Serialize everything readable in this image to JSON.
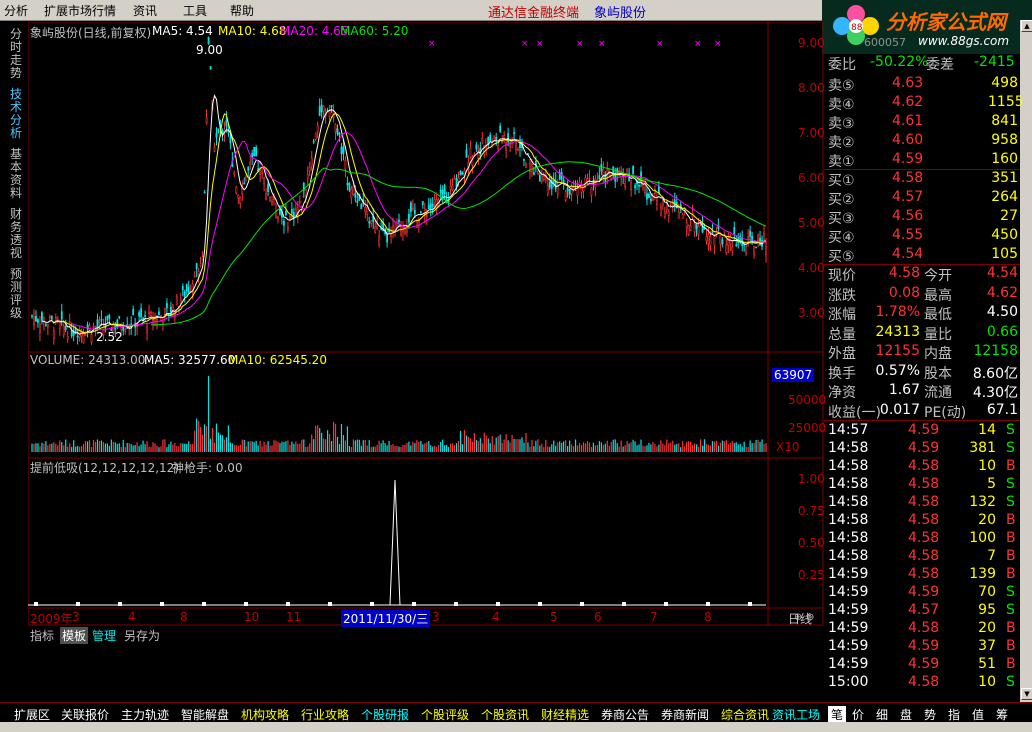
{
  "menu": [
    "分析",
    "扩展市场行情",
    "资讯",
    "工具",
    "帮助"
  ],
  "app_title": "通达信金融终端",
  "stock_title": "象屿股份",
  "logo": {
    "text": "分析家公式网",
    "url": "www.88gs.com",
    "code": "600057",
    "name": "象屿股份"
  },
  "left_tabs": [
    {
      "label": "分时走势",
      "active": false
    },
    {
      "label": "技术分析",
      "active": true
    },
    {
      "label": "基本资料",
      "active": false
    },
    {
      "label": "财务透视",
      "active": false
    },
    {
      "label": "预测评级",
      "active": false
    }
  ],
  "main_header": {
    "name": "象屿股份(日线,前复权)",
    "ma5": "MA5: 4.54",
    "ma10": "MA10: 4.68",
    "ma20": "MA20: 4.65",
    "ma60": "MA60: 5.20"
  },
  "price_axis": [
    "9.00",
    "8.00",
    "7.00",
    "6.00",
    "5.00",
    "4.00",
    "3.00"
  ],
  "price_annotations": {
    "high": "9.00",
    "low": "2.52"
  },
  "volume_header": {
    "name": "VOLUME: 24313.00",
    "ma5": "MA5: 32577.60",
    "ma10": "MA10: 62545.20"
  },
  "volume_axis": {
    "top_box": "63907",
    "mid": "50000",
    "low": "25000",
    "unit": "X10"
  },
  "indicator_header": {
    "name": "提前低吸(12,12,12,12,12)",
    "value": "神枪手: 0.00"
  },
  "indicator_axis": [
    "1.00",
    "0.75",
    "0.50",
    "0.25"
  ],
  "date_axis": {
    "labels": [
      "2009年",
      "3",
      "4",
      "8",
      "10",
      "11",
      "3",
      "4",
      "5",
      "6",
      "7",
      "8"
    ],
    "cursor_date": "2011/11/30/三",
    "period": "日线"
  },
  "sub_tabs": [
    "指标",
    "模板",
    "管理",
    "另存为"
  ],
  "quote": {
    "header": {
      "left_label": "委比",
      "left_value": "-50.22%",
      "right_label": "委差",
      "right_value": "-2415"
    },
    "asks": [
      {
        "label": "卖⑤",
        "price": "4.63",
        "vol": "498"
      },
      {
        "label": "卖④",
        "price": "4.62",
        "vol": "1155"
      },
      {
        "label": "卖③",
        "price": "4.61",
        "vol": "841"
      },
      {
        "label": "卖②",
        "price": "4.60",
        "vol": "958"
      },
      {
        "label": "卖①",
        "price": "4.59",
        "vol": "160"
      }
    ],
    "bids": [
      {
        "label": "买①",
        "price": "4.58",
        "vol": "351"
      },
      {
        "label": "买②",
        "price": "4.57",
        "vol": "264"
      },
      {
        "label": "买③",
        "price": "4.56",
        "vol": "27"
      },
      {
        "label": "买④",
        "price": "4.55",
        "vol": "450"
      },
      {
        "label": "买⑤",
        "price": "4.54",
        "vol": "105"
      }
    ],
    "stats": [
      {
        "l1": "现价",
        "v1": "4.58",
        "c1": "red",
        "l2": "今开",
        "v2": "4.54",
        "c2": "red"
      },
      {
        "l1": "涨跌",
        "v1": "0.08",
        "c1": "red",
        "l2": "最高",
        "v2": "4.62",
        "c2": "red"
      },
      {
        "l1": "涨幅",
        "v1": "1.78%",
        "c1": "red",
        "l2": "最低",
        "v2": "4.50",
        "c2": "white"
      },
      {
        "l1": "总量",
        "v1": "24313",
        "c1": "yellow",
        "l2": "量比",
        "v2": "0.66",
        "c2": "green"
      },
      {
        "l1": "外盘",
        "v1": "12155",
        "c1": "red",
        "l2": "内盘",
        "v2": "12158",
        "c2": "green"
      },
      {
        "l1": "换手",
        "v1": "0.57%",
        "c1": "white",
        "l2": "股本",
        "v2": "8.60亿",
        "c2": "white"
      },
      {
        "l1": "净资",
        "v1": "1.67",
        "c1": "white",
        "l2": "流通",
        "v2": "4.30亿",
        "c2": "white"
      },
      {
        "l1": "收益(一)",
        "v1": "0.017",
        "c1": "white",
        "l2": "PE(动)",
        "v2": "67.1",
        "c2": "white"
      }
    ],
    "ticks": [
      {
        "time": "14:57",
        "price": "4.59",
        "vol": "14",
        "side": "S"
      },
      {
        "time": "14:58",
        "price": "4.59",
        "vol": "381",
        "side": "S"
      },
      {
        "time": "14:58",
        "price": "4.58",
        "vol": "10",
        "side": "B"
      },
      {
        "time": "14:58",
        "price": "4.58",
        "vol": "5",
        "side": "S"
      },
      {
        "time": "14:58",
        "price": "4.58",
        "vol": "132",
        "side": "S"
      },
      {
        "time": "14:58",
        "price": "4.58",
        "vol": "20",
        "side": "B"
      },
      {
        "time": "14:58",
        "price": "4.58",
        "vol": "100",
        "side": "B"
      },
      {
        "time": "14:58",
        "price": "4.58",
        "vol": "7",
        "side": "B"
      },
      {
        "time": "14:59",
        "price": "4.58",
        "vol": "139",
        "side": "B"
      },
      {
        "time": "14:59",
        "price": "4.59",
        "vol": "70",
        "side": "S"
      },
      {
        "time": "14:59",
        "price": "4.57",
        "vol": "95",
        "side": "S"
      },
      {
        "time": "14:59",
        "price": "4.58",
        "vol": "20",
        "side": "B"
      },
      {
        "time": "14:59",
        "price": "4.59",
        "vol": "37",
        "side": "B"
      },
      {
        "time": "14:59",
        "price": "4.59",
        "vol": "51",
        "side": "B"
      },
      {
        "time": "15:00",
        "price": "4.58",
        "vol": "10",
        "side": "S"
      }
    ]
  },
  "bottom_tabs": [
    {
      "label": "扩展区",
      "color": "white"
    },
    {
      "label": "关联报价",
      "color": "white"
    },
    {
      "label": "主力轨迹",
      "color": "white"
    },
    {
      "label": "智能解盘",
      "color": "white"
    },
    {
      "label": "机构攻略",
      "color": "yellow"
    },
    {
      "label": "行业攻略",
      "color": "yellow"
    },
    {
      "label": "个股研报",
      "color": "cyan"
    },
    {
      "label": "个股评级",
      "color": "yellow"
    },
    {
      "label": "个股资讯",
      "color": "yellow"
    },
    {
      "label": "财经精选",
      "color": "yellow"
    },
    {
      "label": "券商公告",
      "color": "white"
    },
    {
      "label": "券商新闻",
      "color": "white"
    },
    {
      "label": "综合资讯",
      "color": "yellow"
    }
  ],
  "right_bottom_tabs": [
    "资讯工场",
    "笔",
    "价",
    "细",
    "盘",
    "势",
    "指",
    "值",
    "筹"
  ],
  "colors": {
    "up": "#ff3232",
    "down": "#00e6e6",
    "ma5": "#ffffff",
    "ma10": "#ffff00",
    "ma20": "#ff00ff",
    "ma60": "#00e600",
    "axis": "#c00000"
  }
}
